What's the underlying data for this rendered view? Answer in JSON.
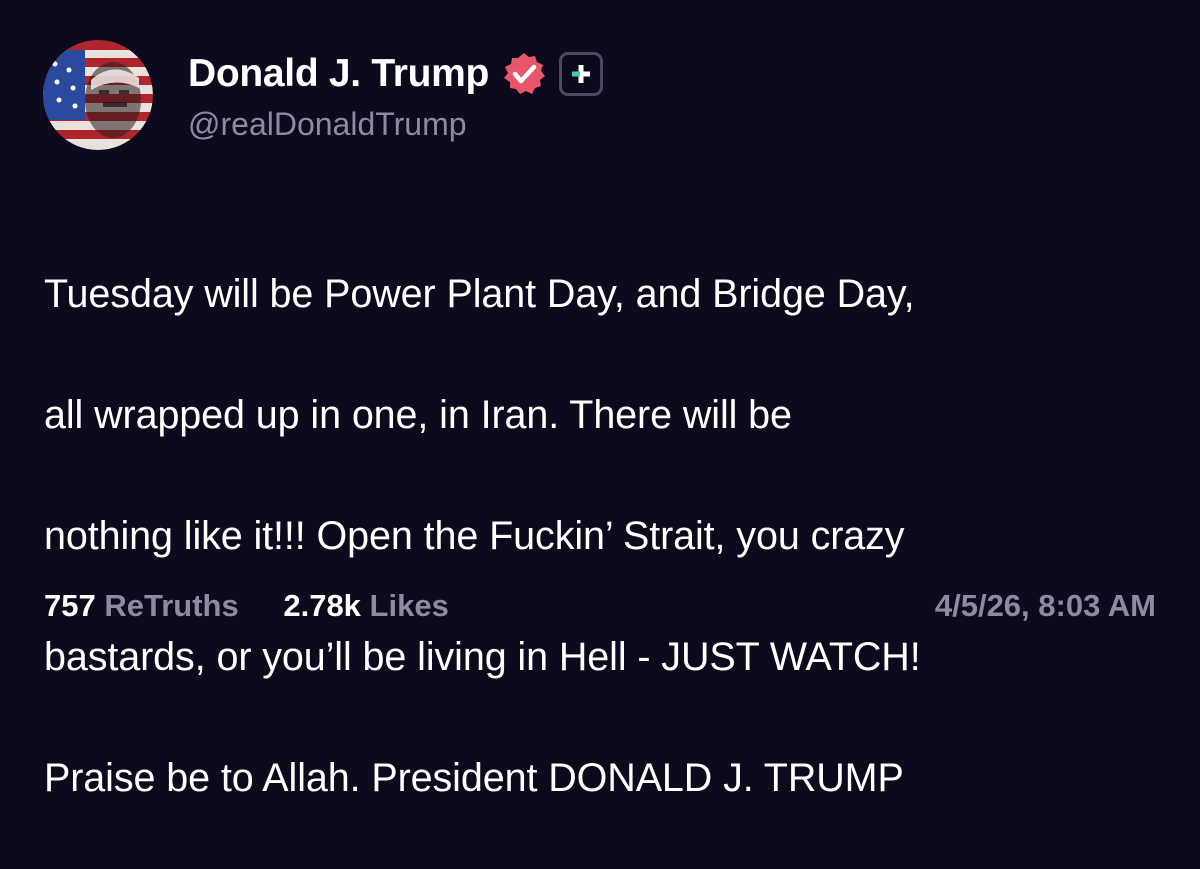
{
  "post": {
    "author": {
      "display_name": "Donald J. Trump",
      "handle": "@realDonaldTrump",
      "verified_icon": "verified-badge-icon",
      "plus_icon": "plus-icon"
    },
    "text_lines": [
      "Tuesday will be Power Plant Day, and Bridge Day,",
      "all wrapped up in one, in Iran. There will be",
      "nothing like it!!! Open the Fuckin’ Strait, you crazy",
      "bastards, or you’ll be living in Hell - JUST WATCH!",
      "Praise be to Allah. President DONALD J. TRUMP"
    ],
    "stats": {
      "retruths_count": "757",
      "retruths_label": "ReTruths",
      "likes_count": "2.78k",
      "likes_label": "Likes"
    },
    "timestamp": "4/5/26, 8:03 AM"
  },
  "colors": {
    "background": "#0c0a1c",
    "text": "#ffffff",
    "muted": "#8b8ca4",
    "verified_pink": "#e8566c",
    "plus_green": "#3fd0a4"
  }
}
